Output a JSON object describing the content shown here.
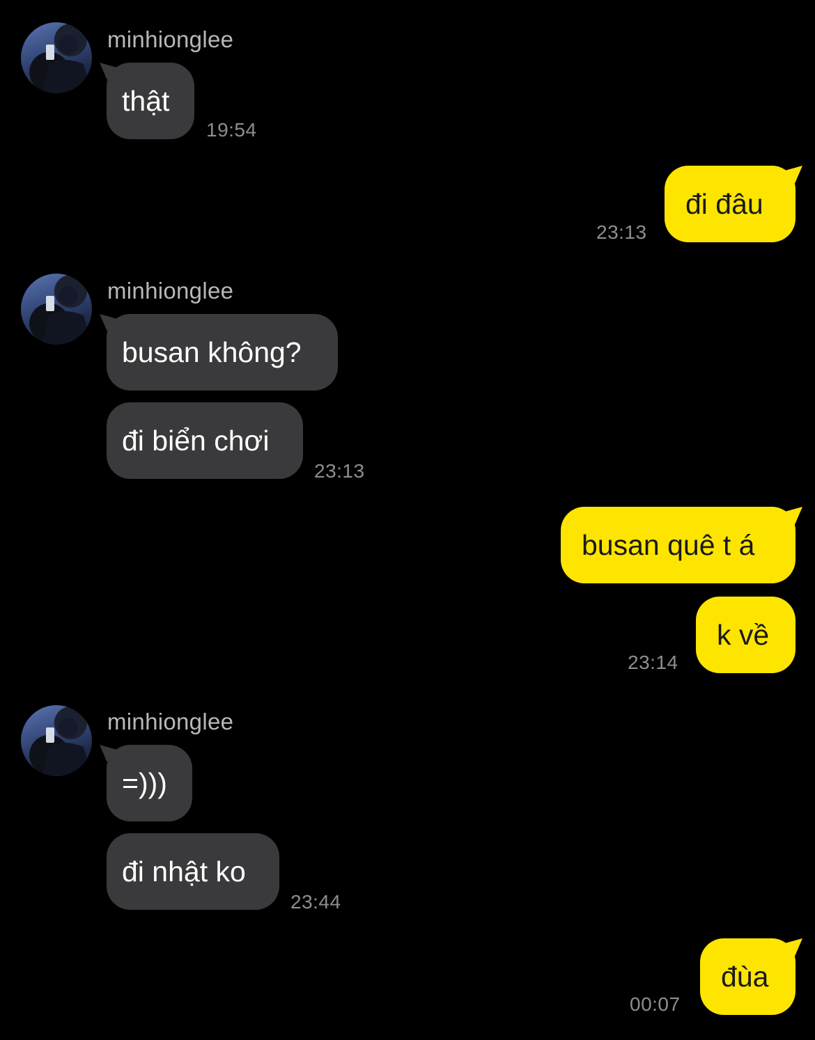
{
  "contact": {
    "name": "minhionglee"
  },
  "colors": {
    "background": "#000000",
    "incoming_bubble": "#3a3a3c",
    "outgoing_bubble": "#fee500",
    "timestamp": "#8e8e8e"
  },
  "messages": [
    {
      "side": "in",
      "sender": "minhionglee",
      "texts": [
        "thật"
      ],
      "time": "19:54"
    },
    {
      "side": "out",
      "texts": [
        "đi đâu"
      ],
      "time": "23:13"
    },
    {
      "side": "in",
      "sender": "minhionglee",
      "texts": [
        "busan không?",
        "đi biển chơi"
      ],
      "time": "23:13"
    },
    {
      "side": "out",
      "texts": [
        "busan quê t á",
        "k về"
      ],
      "time": "23:14"
    },
    {
      "side": "in",
      "sender": "minhionglee",
      "texts": [
        "=)))",
        "đi nhật ko"
      ],
      "time": "23:44"
    },
    {
      "side": "out",
      "texts": [
        "đùa"
      ],
      "time": "00:07"
    }
  ]
}
